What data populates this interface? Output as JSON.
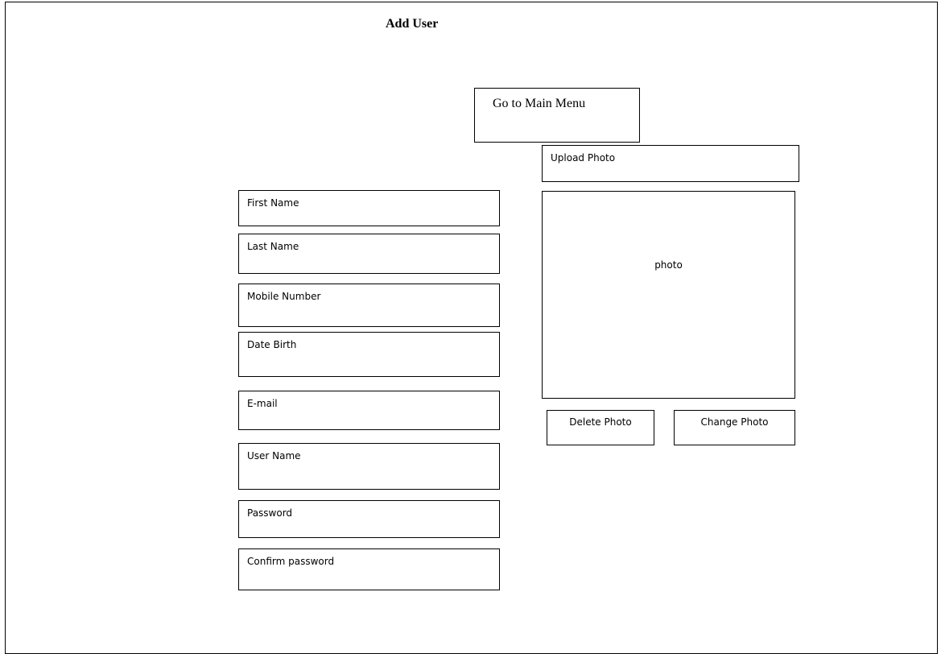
{
  "page": {
    "title": "Add User"
  },
  "actions": {
    "main_menu_label": "Go to Main Menu",
    "upload_photo_label": "Upload Photo",
    "delete_photo_label": "Delete Photo",
    "change_photo_label": "Change Photo"
  },
  "photo": {
    "placeholder_label": "photo"
  },
  "form": {
    "fields": [
      {
        "label": "First Name"
      },
      {
        "label": "Last Name"
      },
      {
        "label": "Mobile Number"
      },
      {
        "label": "Date Birth"
      },
      {
        "label": "E-mail"
      },
      {
        "label": "User Name"
      },
      {
        "label": "Password"
      },
      {
        "label": "Confirm password"
      }
    ]
  }
}
